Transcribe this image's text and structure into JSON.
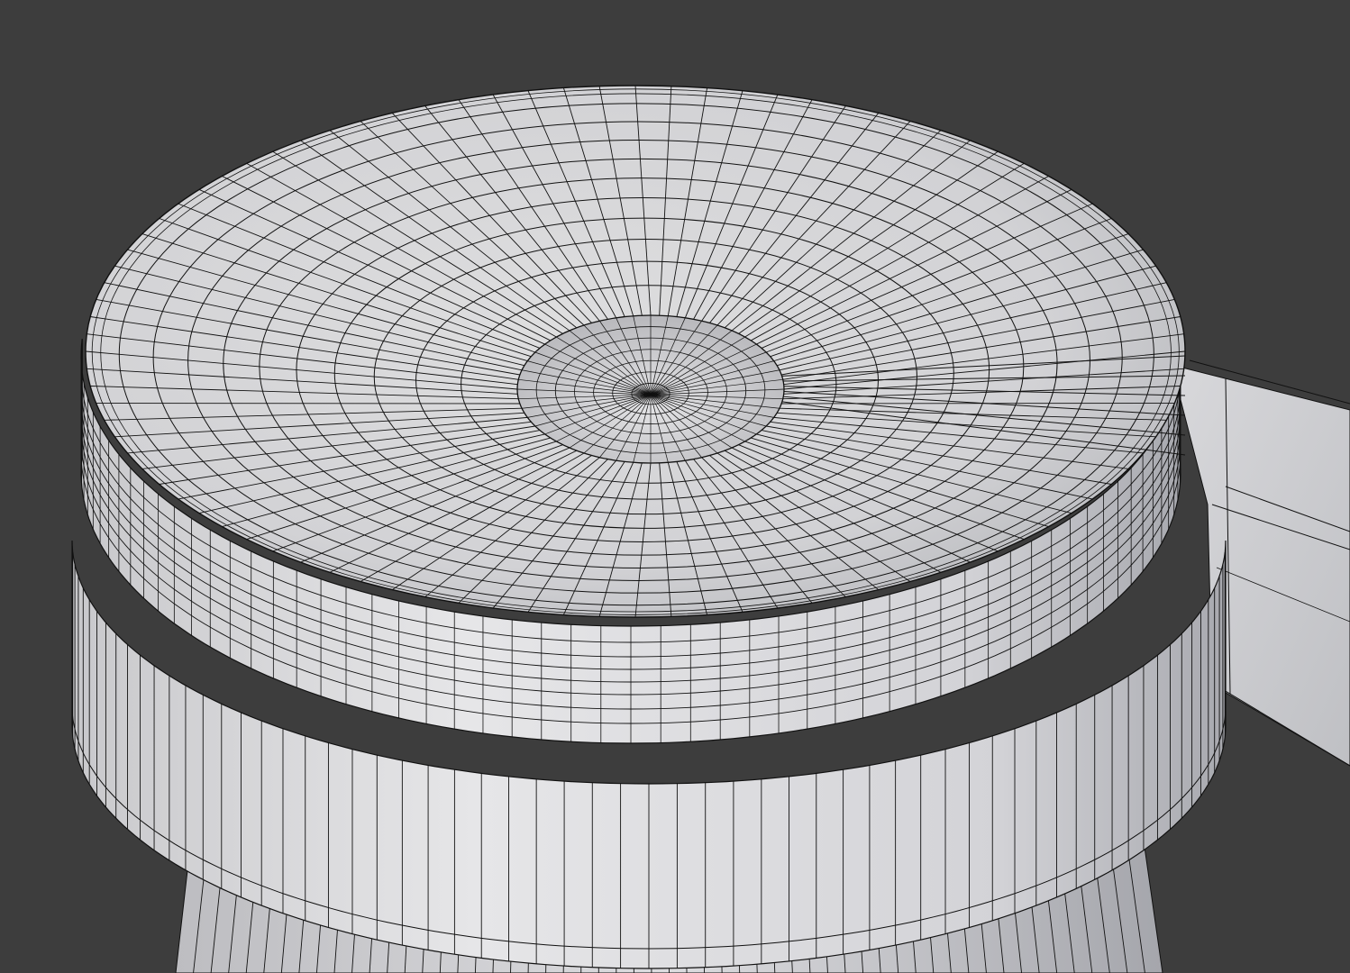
{
  "viewport": {
    "background_color": "#3d3d3d",
    "mesh_fill_color": "#d9d9dc",
    "mesh_shadow_color": "#a7a8ae",
    "wireframe_color": "#111111"
  },
  "scene": {
    "object": "cylindrical-cap-mesh",
    "display_mode": "solid-wireframe-overlay",
    "parts": [
      "top-face-radial-grid",
      "center-dimple",
      "outer-rim-band",
      "upper-rim-band",
      "lower-shaft",
      "side-handle-strip"
    ]
  }
}
